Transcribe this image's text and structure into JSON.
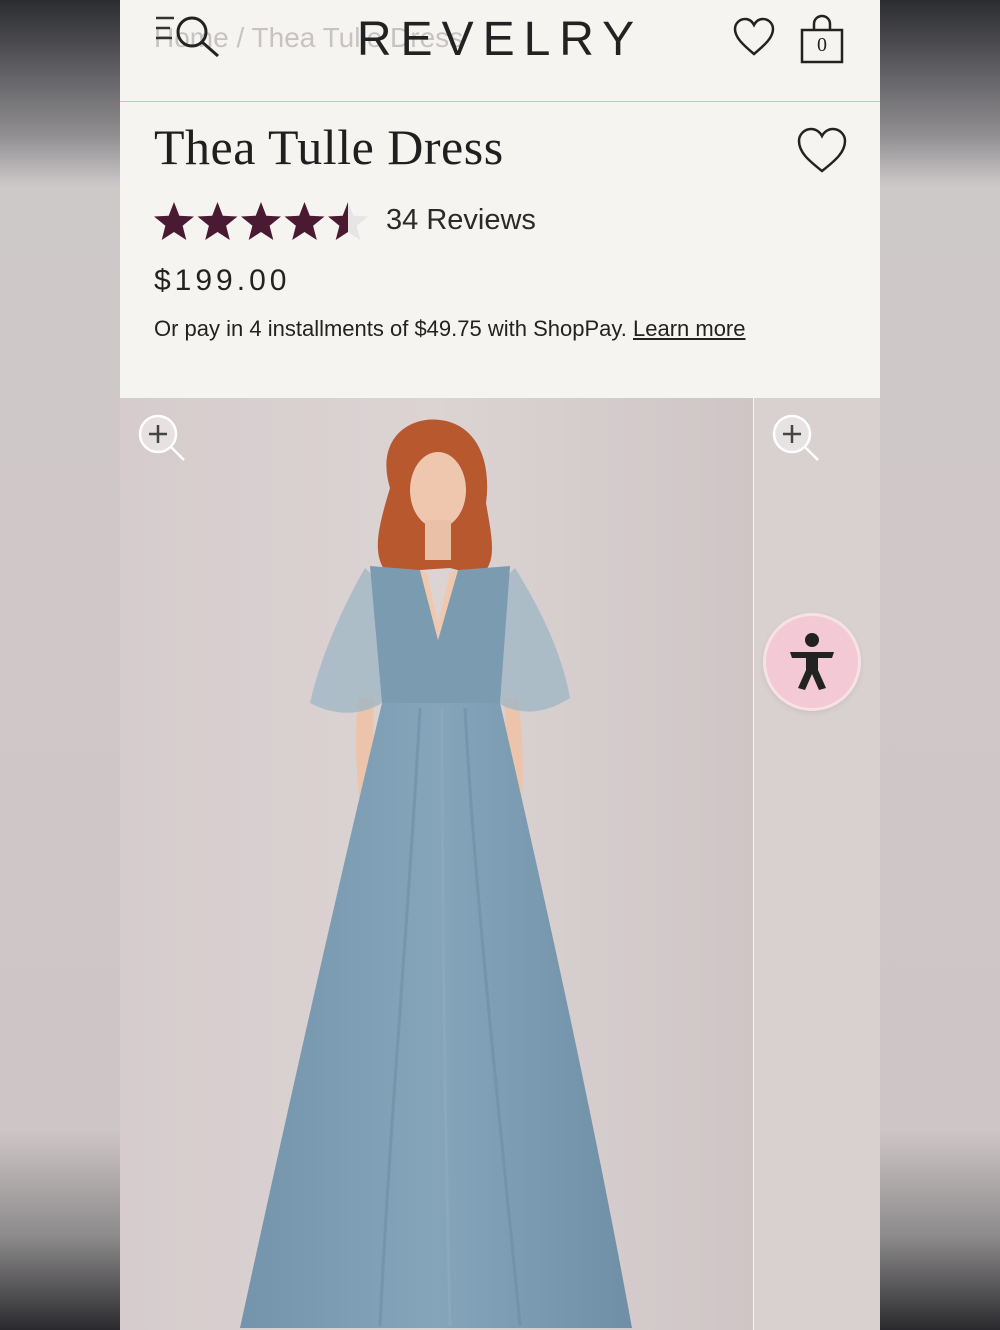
{
  "header": {
    "breadcrumb": "Home / Thea Tulle Dress",
    "logo": "REVELRY",
    "cart_count": "0"
  },
  "product": {
    "title": "Thea Tulle Dress",
    "rating": 4.5,
    "rating_max": 5,
    "reviews": "34 Reviews",
    "price": "$199.00",
    "installments_text": "Or pay in 4 installments of $49.75 with ShopPay.",
    "learn_more": "Learn more"
  },
  "colors": {
    "star": "#4a1a33",
    "star_empty": "#e6e4e4",
    "dress": "#7d9db3",
    "accessibility_bg": "#f2c9d4"
  },
  "icons": [
    "menu-icon",
    "search-icon",
    "heart-icon",
    "shopping-bag-icon",
    "zoom-in-icon",
    "accessibility-icon"
  ]
}
